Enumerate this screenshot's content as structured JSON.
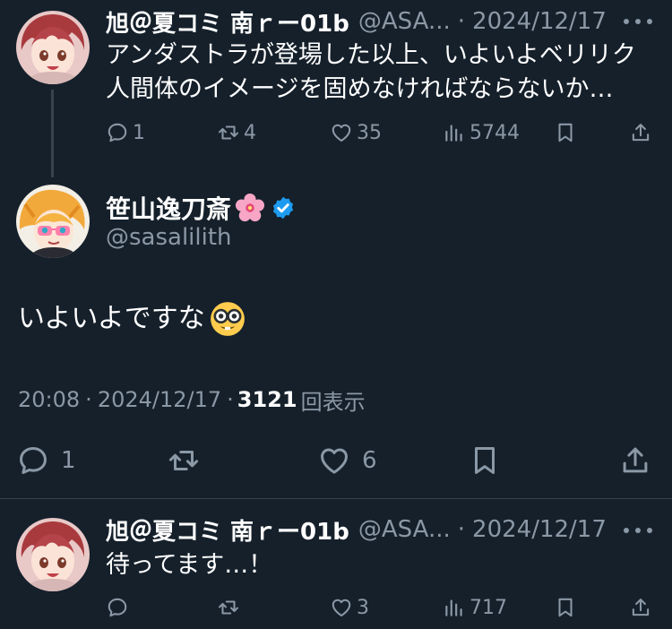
{
  "reply_parent": {
    "display_name": "旭＠夏コミ 南ｒー01b",
    "handle": "@ASA...",
    "separator": "·",
    "date": "2024/12/17",
    "text": "アンダストラが登場した以上、いよいよベリリク人間体のイメージを固めなければならないか…",
    "replies": "1",
    "retweets": "4",
    "likes": "35",
    "views": "5744"
  },
  "main_tweet": {
    "display_name": "笹山逸刀斎",
    "handle": "@sasalilith",
    "text": "いよいよですな",
    "time": "20:08",
    "separator": "·",
    "date": "2024/12/17",
    "separator2": "·",
    "views_count": "3121",
    "views_label": "回表示",
    "replies": "1",
    "likes": "6",
    "verified_color": "#1d9bf0"
  },
  "reply": {
    "display_name": "旭＠夏コミ 南ｒー01b",
    "handle": "@ASA...",
    "separator": "·",
    "date": "2024/12/17",
    "text": "待ってます…！",
    "likes": "3",
    "views": "717"
  },
  "icons": [
    "reply-icon",
    "retweet-icon",
    "like-icon",
    "views-icon",
    "bookmark-icon",
    "share-icon",
    "more-icon",
    "verified-badge-icon",
    "cherry-blossom-icon",
    "nerd-face-icon"
  ],
  "colors": {
    "background": "#15202b",
    "muted": "#8b98a5",
    "divider": "#38444d",
    "accent": "#1d9bf0"
  }
}
